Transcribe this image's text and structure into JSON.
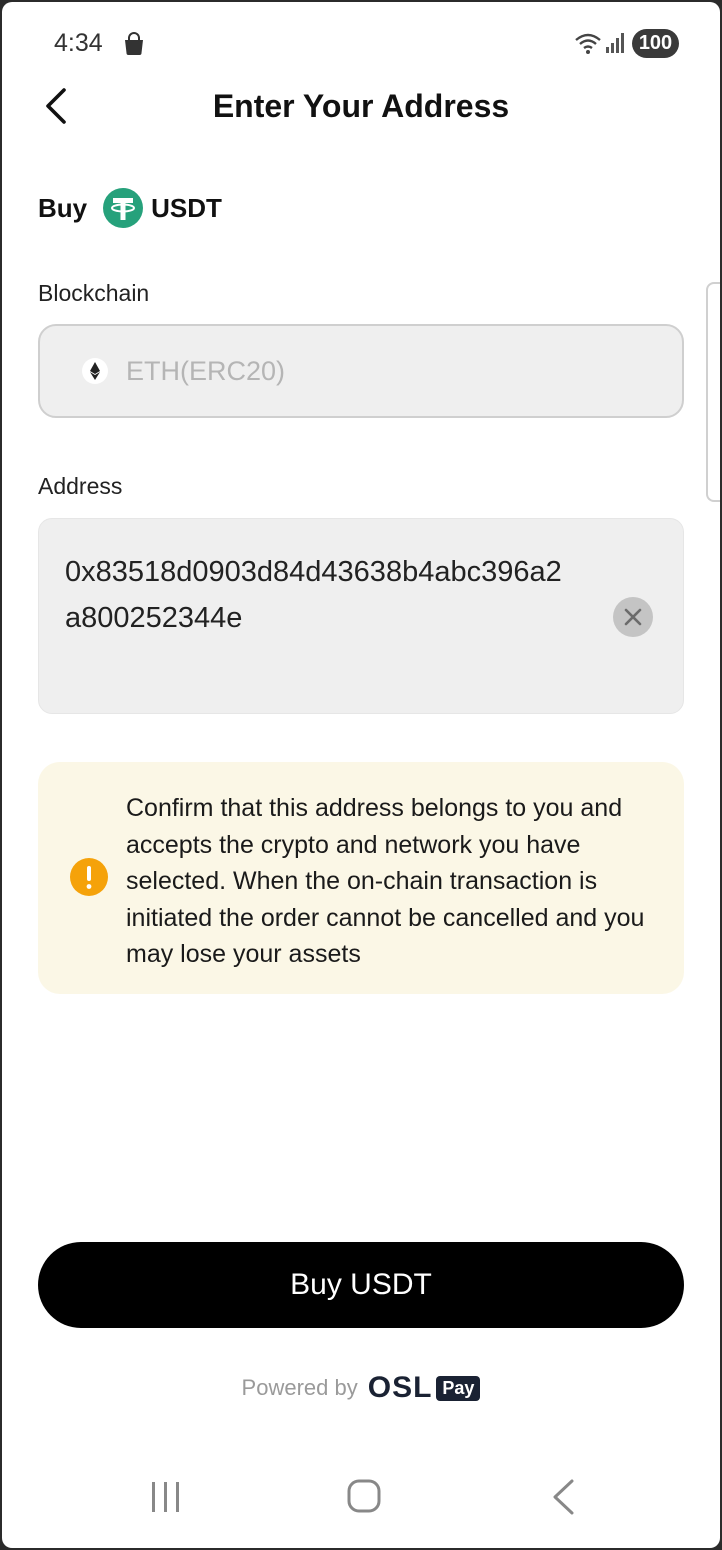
{
  "status_bar": {
    "time": "4:34",
    "battery": "100"
  },
  "header": {
    "title": "Enter Your Address"
  },
  "buy_row": {
    "label": "Buy",
    "asset": "USDT"
  },
  "blockchain": {
    "label": "Blockchain",
    "value": "ETH(ERC20)"
  },
  "address": {
    "label": "Address",
    "value": "0x83518d0903d84d43638b4abc396a2a800252344e"
  },
  "warning": {
    "text": "Confirm that this address belongs to you and accepts the crypto and network you have selected. When the on-chain transaction is initiated the order cannot be cancelled and you may lose your assets"
  },
  "buy_button": {
    "label": "Buy USDT"
  },
  "footer": {
    "powered_by": "Powered by",
    "brand": "OSL",
    "brand_badge": "Pay"
  },
  "colors": {
    "tether_green": "#26A17B",
    "warning_orange": "#F5A20A",
    "button_black": "#000000",
    "warning_bg": "#FBF7E6"
  }
}
